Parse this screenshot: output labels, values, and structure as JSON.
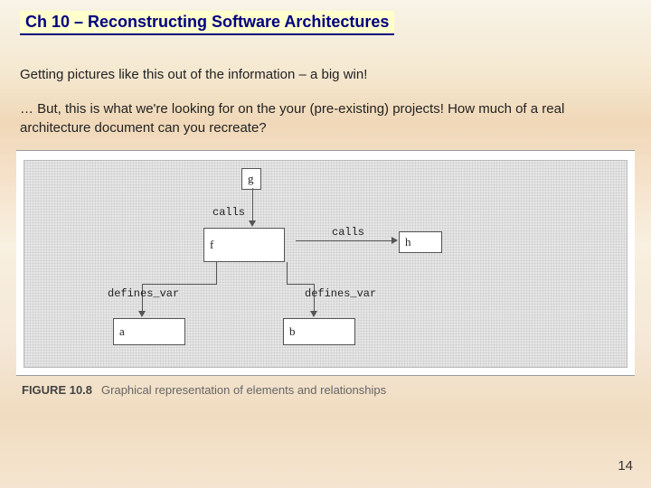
{
  "title": "Ch 10 – Reconstructing Software Architectures",
  "para1": "Getting pictures like this out of the information – a big win!",
  "para2": "… But, this is what we're looking for on the your (pre-existing) projects!  How much of a real architecture document can you recreate?",
  "diagram": {
    "nodes": {
      "g": "g",
      "f": "f",
      "h": "h",
      "a": "a",
      "b": "b"
    },
    "edges": {
      "g_f": "calls",
      "f_h": "calls",
      "f_a": "defines_var",
      "h_b": "defines_var"
    }
  },
  "caption": {
    "label": "FIGURE 10.8",
    "text": "Graphical representation of elements and relationships"
  },
  "page": "14"
}
